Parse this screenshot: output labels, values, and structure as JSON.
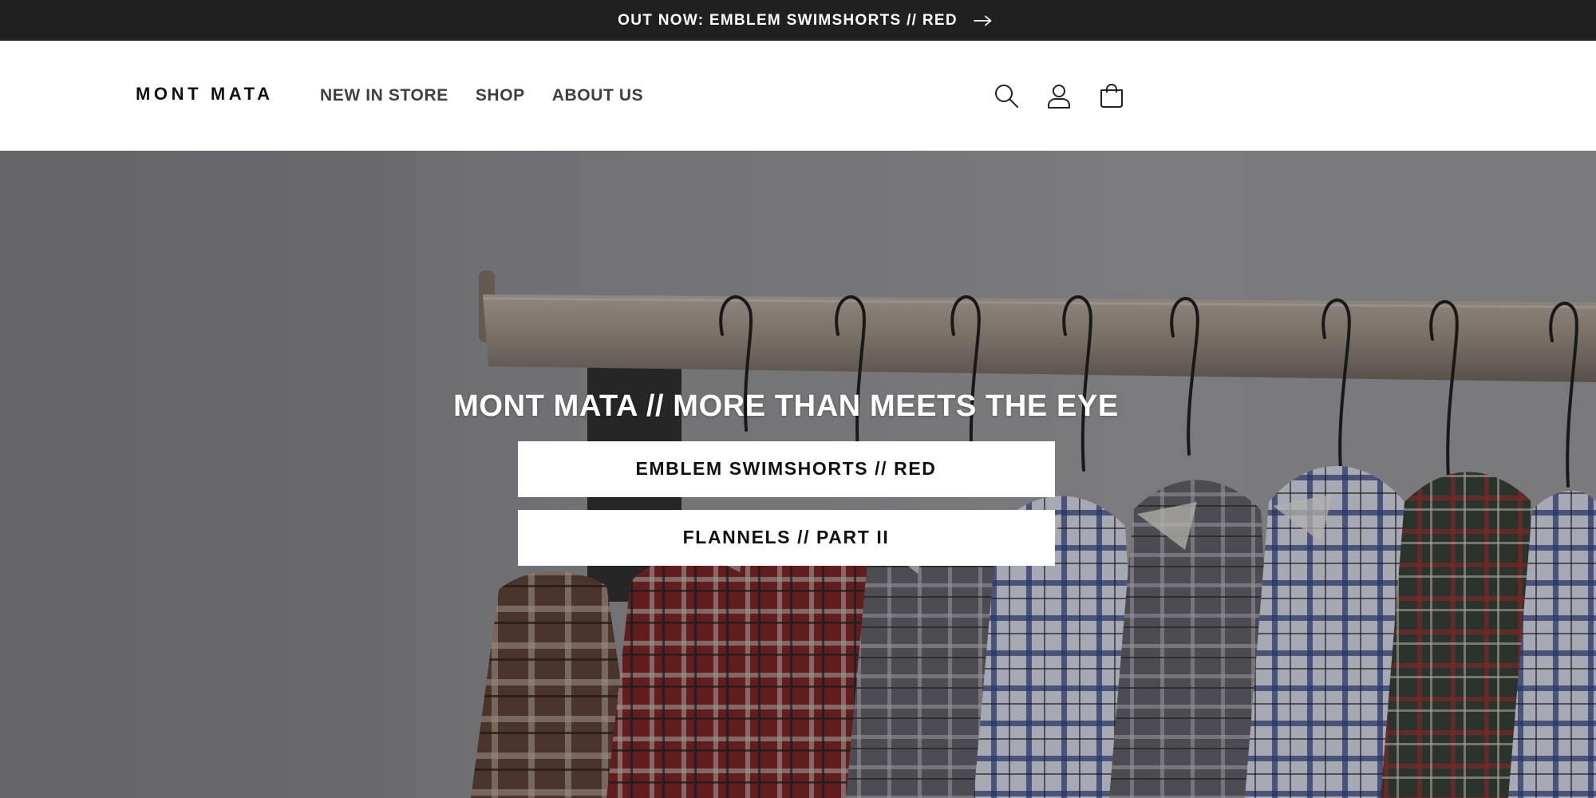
{
  "announcement": {
    "text": "OUT NOW: EMBLEM SWIMSHORTS // RED",
    "icon": "arrow-right-icon"
  },
  "header": {
    "logo": "MONT MATA",
    "nav": [
      {
        "label": "NEW IN STORE"
      },
      {
        "label": "SHOP"
      },
      {
        "label": "ABOUT US"
      }
    ],
    "icons": [
      "search-icon",
      "account-icon",
      "cart-icon"
    ]
  },
  "hero": {
    "heading": "MONT MATA // MORE THAN MEETS THE EYE",
    "buttons": [
      {
        "label": "EMBLEM SWIMSHORTS // RED"
      },
      {
        "label": "FLANNELS // PART II"
      }
    ]
  },
  "colors": {
    "announcement_bg": "#202020",
    "header_bg": "#ffffff",
    "nav_text": "#3f3f3f",
    "button_bg": "#ffffff",
    "button_text": "#111111"
  }
}
